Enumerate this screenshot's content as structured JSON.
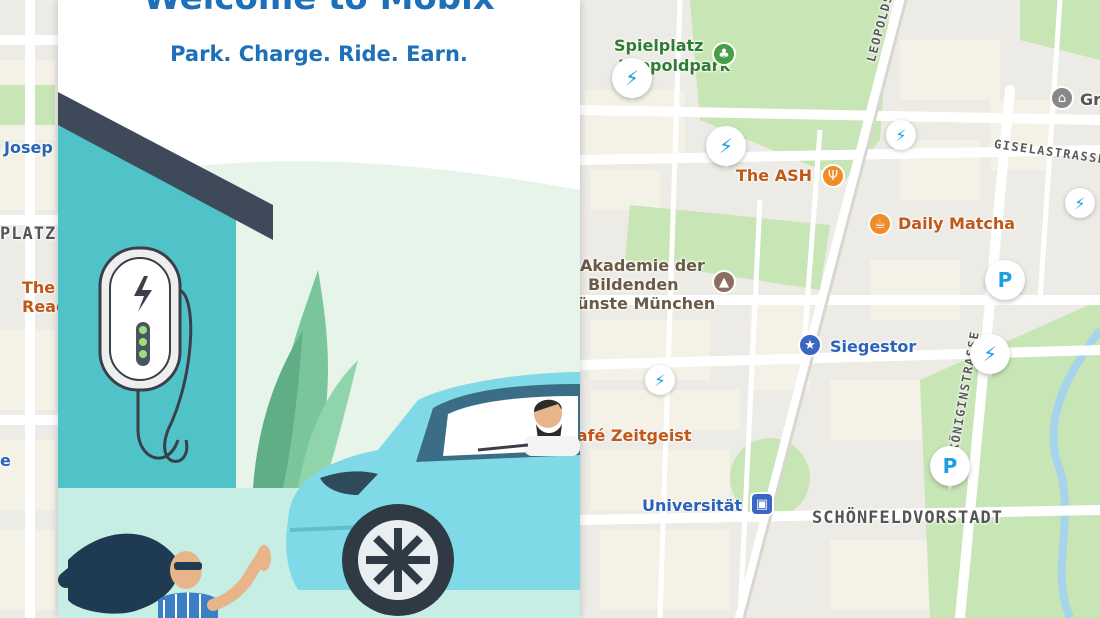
{
  "modal": {
    "title": "Welcome to Mobix",
    "tagline": "Park. Charge. Ride. Earn."
  },
  "map": {
    "labels": {
      "spielplatz": "Spielplatz",
      "leopoldpark": "Leopoldpark",
      "the_ash": "The ASH",
      "daily_matcha": "Daily Matcha",
      "akademie_1": "Akademie der",
      "akademie_2": "Bildenden",
      "akademie_3": "Künste München",
      "siegestor": "Siegestor",
      "cafe_zeitgeist": "Café Zeitgeist",
      "universitaet": "Universität",
      "schoenfeldvorstadt": "SCHÖNFELDVORSTADT",
      "leopoldstrasse": "LEOPOLDSTRASSE",
      "giselastrasse": "GISELASTRASSE",
      "koeniginstrasse": "KÖNIGINSTRASSE",
      "gr": "Gr",
      "josep": "Josep",
      "platz": "PLATZ",
      "the": "The",
      "read": "Read",
      "e": "e"
    },
    "pins": {
      "parking_symbol": "P",
      "charge_symbol": "⚡"
    },
    "icons": {
      "park_icon": "tree-icon",
      "restaurant_icon": "fork-knife-icon",
      "cafe_icon": "cup-icon",
      "school_icon": "graduation-cap-icon",
      "landmark_icon": "star-icon",
      "transit_icon": "train-icon",
      "museum_icon": "building-icon"
    },
    "colors": {
      "park_green": "#c5e3b4",
      "road_white": "#ffffff",
      "block": "#f2eedf",
      "charge_blue": "#1aa0e0"
    }
  }
}
